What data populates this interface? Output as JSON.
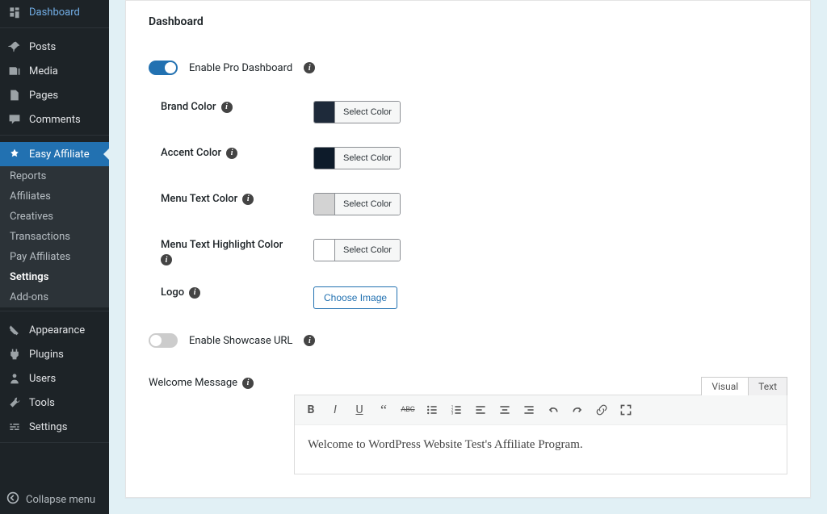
{
  "sidebar": {
    "items": [
      {
        "label": "Dashboard",
        "icon": "dashboard"
      },
      {
        "label": "Posts",
        "icon": "pin"
      },
      {
        "label": "Media",
        "icon": "media"
      },
      {
        "label": "Pages",
        "icon": "pages"
      },
      {
        "label": "Comments",
        "icon": "comments"
      },
      {
        "label": "Easy Affiliate",
        "icon": "plugin",
        "active": true
      }
    ],
    "submenu": [
      {
        "label": "Reports"
      },
      {
        "label": "Affiliates"
      },
      {
        "label": "Creatives"
      },
      {
        "label": "Transactions"
      },
      {
        "label": "Pay Affiliates"
      },
      {
        "label": "Settings",
        "active": true
      },
      {
        "label": "Add-ons"
      }
    ],
    "items2": [
      {
        "label": "Appearance",
        "icon": "appearance"
      },
      {
        "label": "Plugins",
        "icon": "plugins"
      },
      {
        "label": "Users",
        "icon": "users"
      },
      {
        "label": "Tools",
        "icon": "tools"
      },
      {
        "label": "Settings",
        "icon": "settings"
      }
    ],
    "collapse": "Collapse menu"
  },
  "page": {
    "heading": "Dashboard",
    "enable_pro_label": "Enable Pro Dashboard",
    "enable_showcase_label": "Enable Showcase URL",
    "brand_color": {
      "label": "Brand Color",
      "swatch": "#1e2a3a"
    },
    "accent_color": {
      "label": "Accent Color",
      "swatch": "#0d1b2a"
    },
    "menu_text_color": {
      "label": "Menu Text Color",
      "swatch": "#d3d3d3"
    },
    "menu_highlight": {
      "label": "Menu Text Highlight Color",
      "swatch": "#ffffff"
    },
    "logo_label": "Logo",
    "select_color": "Select Color",
    "choose_image": "Choose Image",
    "welcome_label": "Welcome Message",
    "editor_tabs": {
      "visual": "Visual",
      "text": "Text"
    },
    "welcome_text": "Welcome to WordPress Website Test's Affiliate Program."
  }
}
